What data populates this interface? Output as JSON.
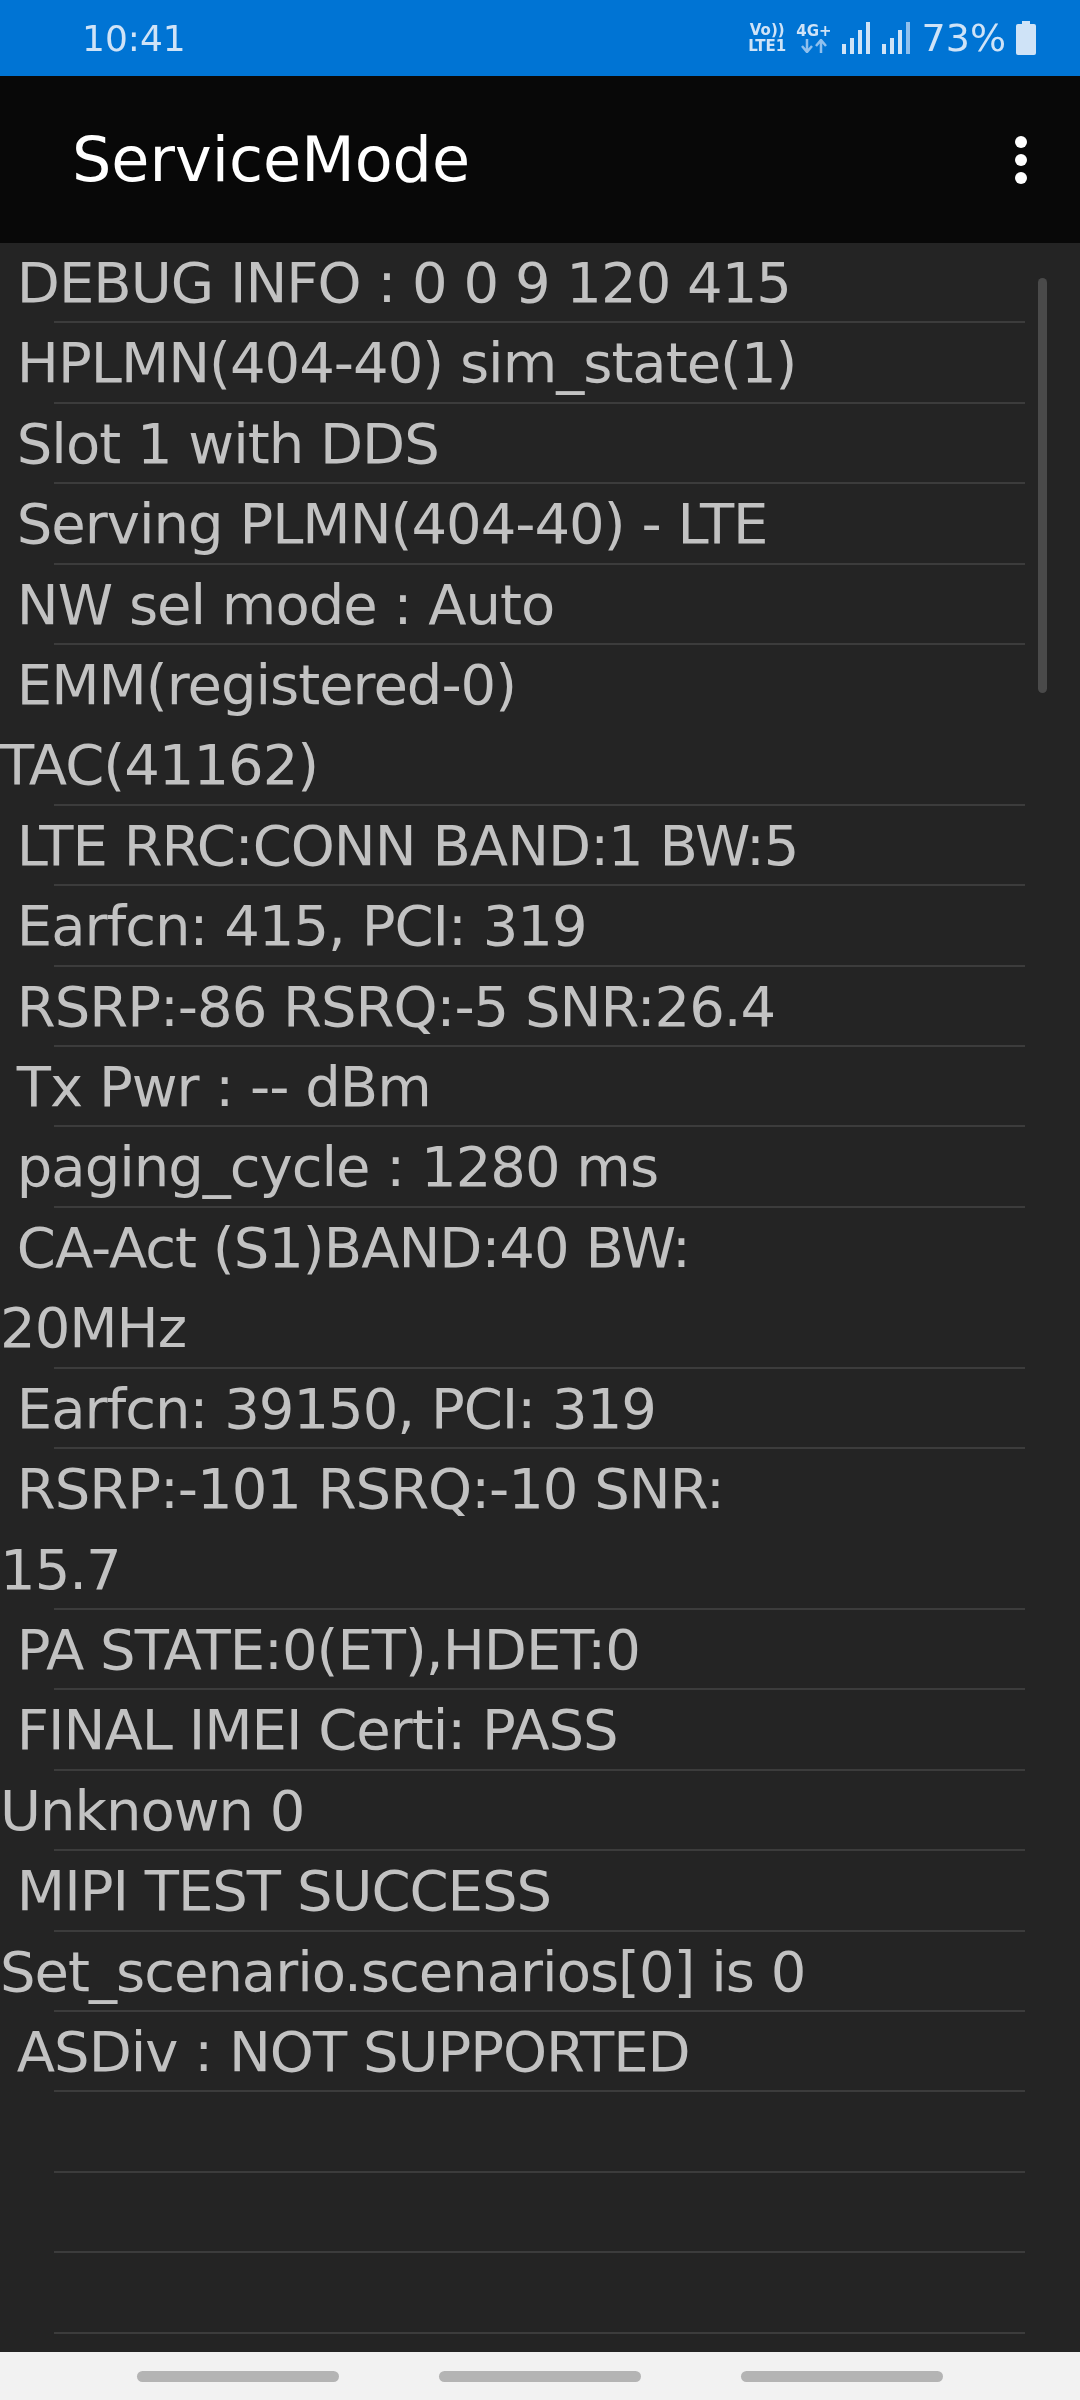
{
  "status_bar": {
    "time": "10:41",
    "volte_top": "Vo))",
    "volte_bottom": "LTE1",
    "network": "4G+",
    "battery": "73%"
  },
  "app_bar": {
    "title": "ServiceMode"
  },
  "lines": [
    {
      "text": " DEBUG INFO : 0 0 9 120 415"
    },
    {
      "text": " HPLMN(404-40) sim_state(1)"
    },
    {
      "text": " Slot 1 with DDS"
    },
    {
      "text": " Serving PLMN(404-40) - LTE"
    },
    {
      "text": " NW sel mode : Auto"
    },
    {
      "text": " EMM(registered-0)\nTAC(41162)"
    },
    {
      "text": " LTE RRC:CONN BAND:1 BW:5"
    },
    {
      "text": " Earfcn: 415, PCI: 319"
    },
    {
      "text": " RSRP:-86 RSRQ:-5 SNR:26.4"
    },
    {
      "text": " Tx Pwr : -- dBm"
    },
    {
      "text": " paging_cycle : 1280 ms"
    },
    {
      "text": " CA-Act (S1)BAND:40 BW:\n20MHz"
    },
    {
      "text": " Earfcn: 39150, PCI: 319"
    },
    {
      "text": " RSRP:-101 RSRQ:-10 SNR:\n15.7"
    },
    {
      "text": " PA STATE:0(ET),HDET:0"
    },
    {
      "text": " FINAL IMEI Certi: PASS"
    },
    {
      "text": "Unknown 0"
    },
    {
      "text": " MIPI TEST SUCCESS"
    },
    {
      "text": "Set_scenario.scenarios[0] is 0"
    },
    {
      "text": " ASDiv : NOT SUPPORTED"
    }
  ]
}
